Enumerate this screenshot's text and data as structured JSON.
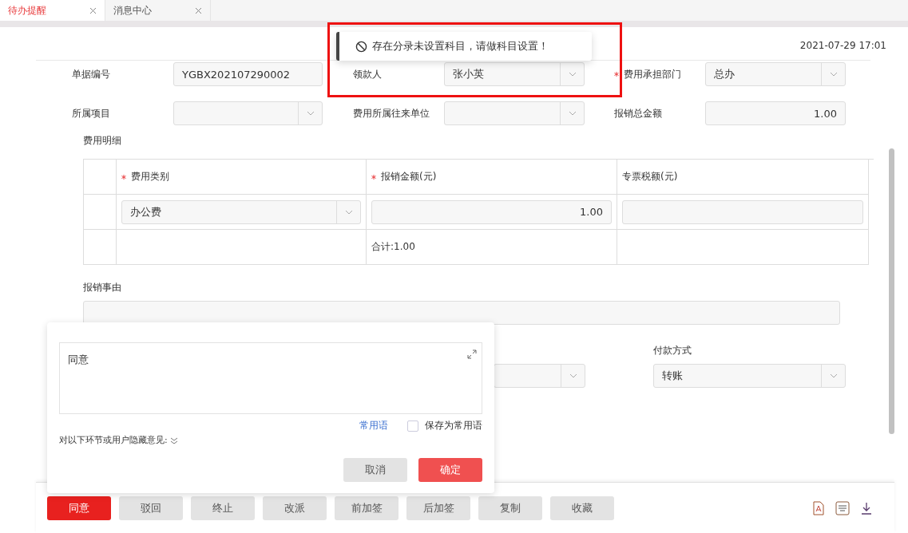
{
  "tabs": [
    {
      "label": "待办提醒",
      "selected": true
    },
    {
      "label": "消息中心",
      "selected": false
    }
  ],
  "header": {
    "datetime": "2021-07-29 17:01"
  },
  "toast": {
    "message": "存在分录未设置科目，请做科目设置！"
  },
  "form_rows": [
    [
      {
        "label": "单据编号",
        "required": false,
        "kind": "text",
        "value": "YGBX202107290002"
      },
      {
        "label": "领款人",
        "required": false,
        "kind": "select",
        "value": "张小英"
      },
      {
        "label": "费用承担部门",
        "required": true,
        "kind": "select",
        "value": "总办"
      }
    ],
    [
      {
        "label": "所属项目",
        "required": false,
        "kind": "select"
      },
      {
        "label": "费用所属往来单位",
        "required": false,
        "kind": "select"
      },
      {
        "label": "报销总金额",
        "required": false,
        "kind": "number",
        "value": "1.00"
      }
    ]
  ],
  "expense_detail": {
    "title": "费用明细",
    "columns": [
      {
        "label": "费用类别",
        "required": true
      },
      {
        "label": "报销金额(元)",
        "required": true
      },
      {
        "label": "专票税额(元)",
        "required": false
      }
    ],
    "rows": [
      {
        "category": "办公费",
        "amount": "1.00"
      }
    ],
    "total": "合计:1.00"
  },
  "reason": {
    "label": "报销事由"
  },
  "payment": {
    "label": "付款方式",
    "value": "转账"
  },
  "popup": {
    "opinion": "同意",
    "phrases_link": "常用语",
    "save_checkbox": {
      "label": "保存为常用语",
      "checked": false
    },
    "hide_opinion": "对以下环节或用户隐藏意见:",
    "buttons": [
      {
        "label": "取消",
        "kind": "secondary"
      },
      {
        "label": "确定",
        "kind": "primary"
      }
    ]
  },
  "action_buttons": [
    {
      "label": "同意",
      "kind": "primary"
    },
    {
      "label": "驳回",
      "kind": "secondary"
    },
    {
      "label": "终止",
      "kind": "secondary"
    },
    {
      "label": "改派",
      "kind": "secondary"
    },
    {
      "label": "前加签",
      "kind": "secondary"
    },
    {
      "label": "后加签",
      "kind": "secondary"
    },
    {
      "label": "复制",
      "kind": "secondary"
    },
    {
      "label": "收藏",
      "kind": "secondary"
    }
  ]
}
